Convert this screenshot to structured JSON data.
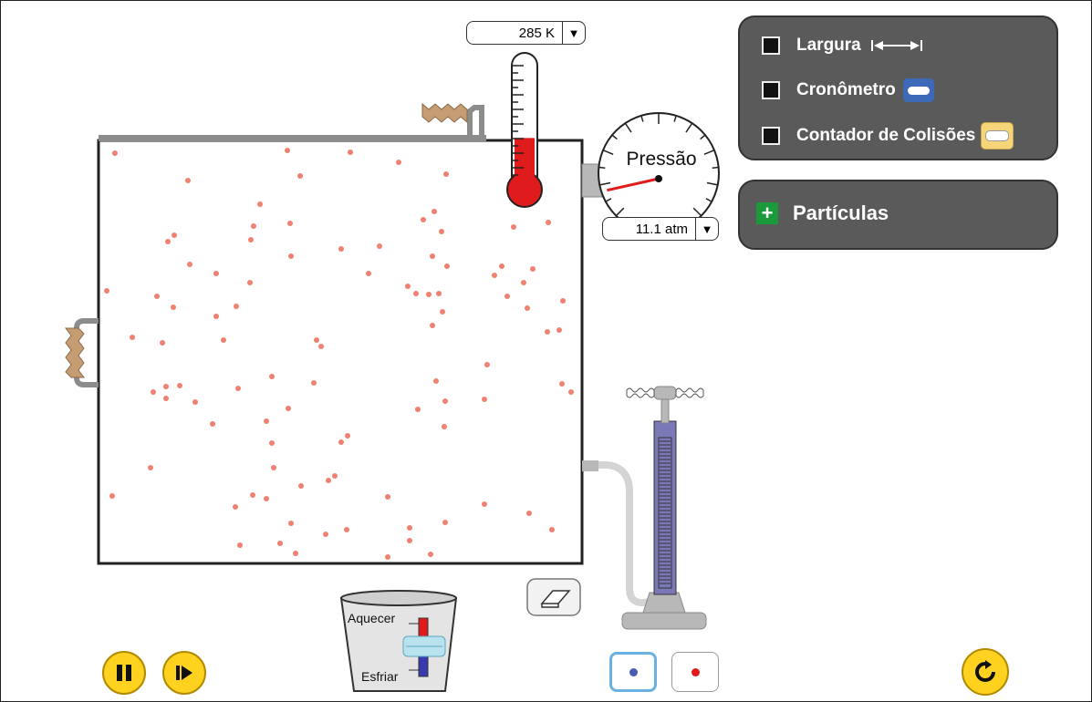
{
  "thermometer": {
    "value": "285 K",
    "arrow": "▼"
  },
  "gauge": {
    "title": "Pressão",
    "value": "11.1 atm",
    "arrow": "▼"
  },
  "tools_panel": {
    "items": [
      {
        "label": "Largura",
        "icon": "width-arrow-icon",
        "checked": false
      },
      {
        "label": "Cronômetro",
        "icon": "stopwatch-icon",
        "checked": false
      },
      {
        "label": "Contador de Colisões",
        "icon": "collision-counter-icon",
        "checked": false
      }
    ]
  },
  "particles_panel": {
    "label": "Partículas",
    "icon": "plus-icon"
  },
  "heater": {
    "heat_label": "Aquecer",
    "cool_label": "Esfriar",
    "level": 0.5
  },
  "colors": {
    "particle": "#f08070",
    "panel": "#5a5a5a",
    "pump": "#7b78b8",
    "button": "#ffd21f",
    "heavy_species": "#4a5cb0",
    "light_species": "#e01b1b"
  },
  "thermometer_fill": 0.38,
  "gauge_needle_fraction": 0.12
}
